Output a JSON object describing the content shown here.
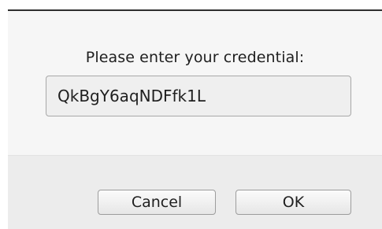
{
  "dialog": {
    "prompt": "Please enter your credential:",
    "credential_value": "QkBgY6aqNDFfk1L",
    "cancel_label": "Cancel",
    "ok_label": "OK"
  }
}
